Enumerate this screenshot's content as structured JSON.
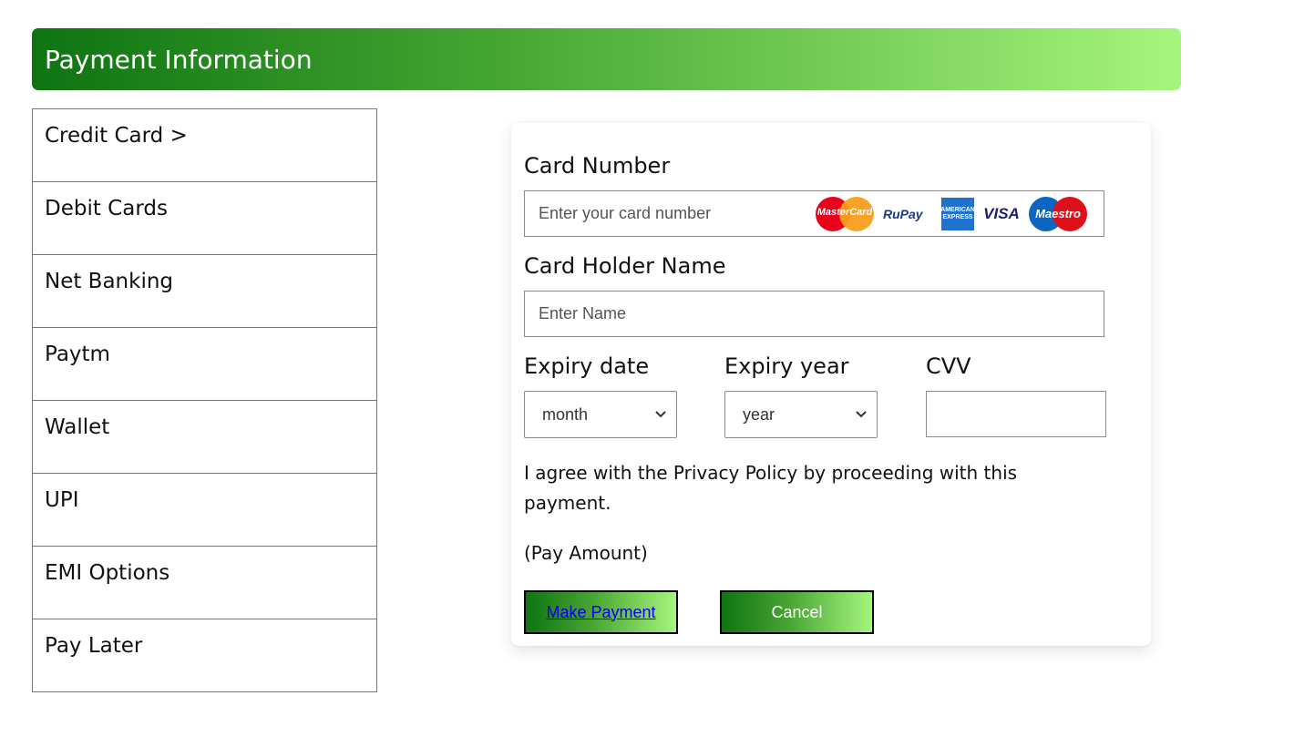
{
  "header": {
    "title": "Payment Information"
  },
  "sidebar": {
    "items": [
      {
        "label": "Credit Card >"
      },
      {
        "label": "Debit Cards"
      },
      {
        "label": "Net Banking"
      },
      {
        "label": "Paytm"
      },
      {
        "label": "Wallet"
      },
      {
        "label": "UPI"
      },
      {
        "label": "EMI Options"
      },
      {
        "label": "Pay Later"
      }
    ]
  },
  "form": {
    "card_number": {
      "label": "Card Number",
      "placeholder": "Enter your card number"
    },
    "card_logos": [
      {
        "name": "mastercard-logo",
        "text": "MasterCard"
      },
      {
        "name": "rupay-logo",
        "text": "RuPay"
      },
      {
        "name": "amex-logo",
        "text": "AMERICAN EXPRESS"
      },
      {
        "name": "visa-logo",
        "text": "VISA"
      },
      {
        "name": "maestro-logo",
        "text": "Maestro"
      }
    ],
    "holder_name": {
      "label": "Card Holder Name",
      "placeholder": "Enter Name"
    },
    "expiry_date": {
      "label": "Expiry date",
      "value": "month"
    },
    "expiry_year": {
      "label": "Expiry year",
      "value": "year"
    },
    "cvv": {
      "label": "CVV",
      "value": ""
    },
    "agreement": "I agree with the Privacy Policy by proceeding with this payment.",
    "amount": "(Pay Amount)",
    "make_payment_label": "Make Payment",
    "cancel_label": "Cancel"
  },
  "colors": {
    "accent_dark": "#0e7412",
    "accent_light": "#a6f57e"
  }
}
